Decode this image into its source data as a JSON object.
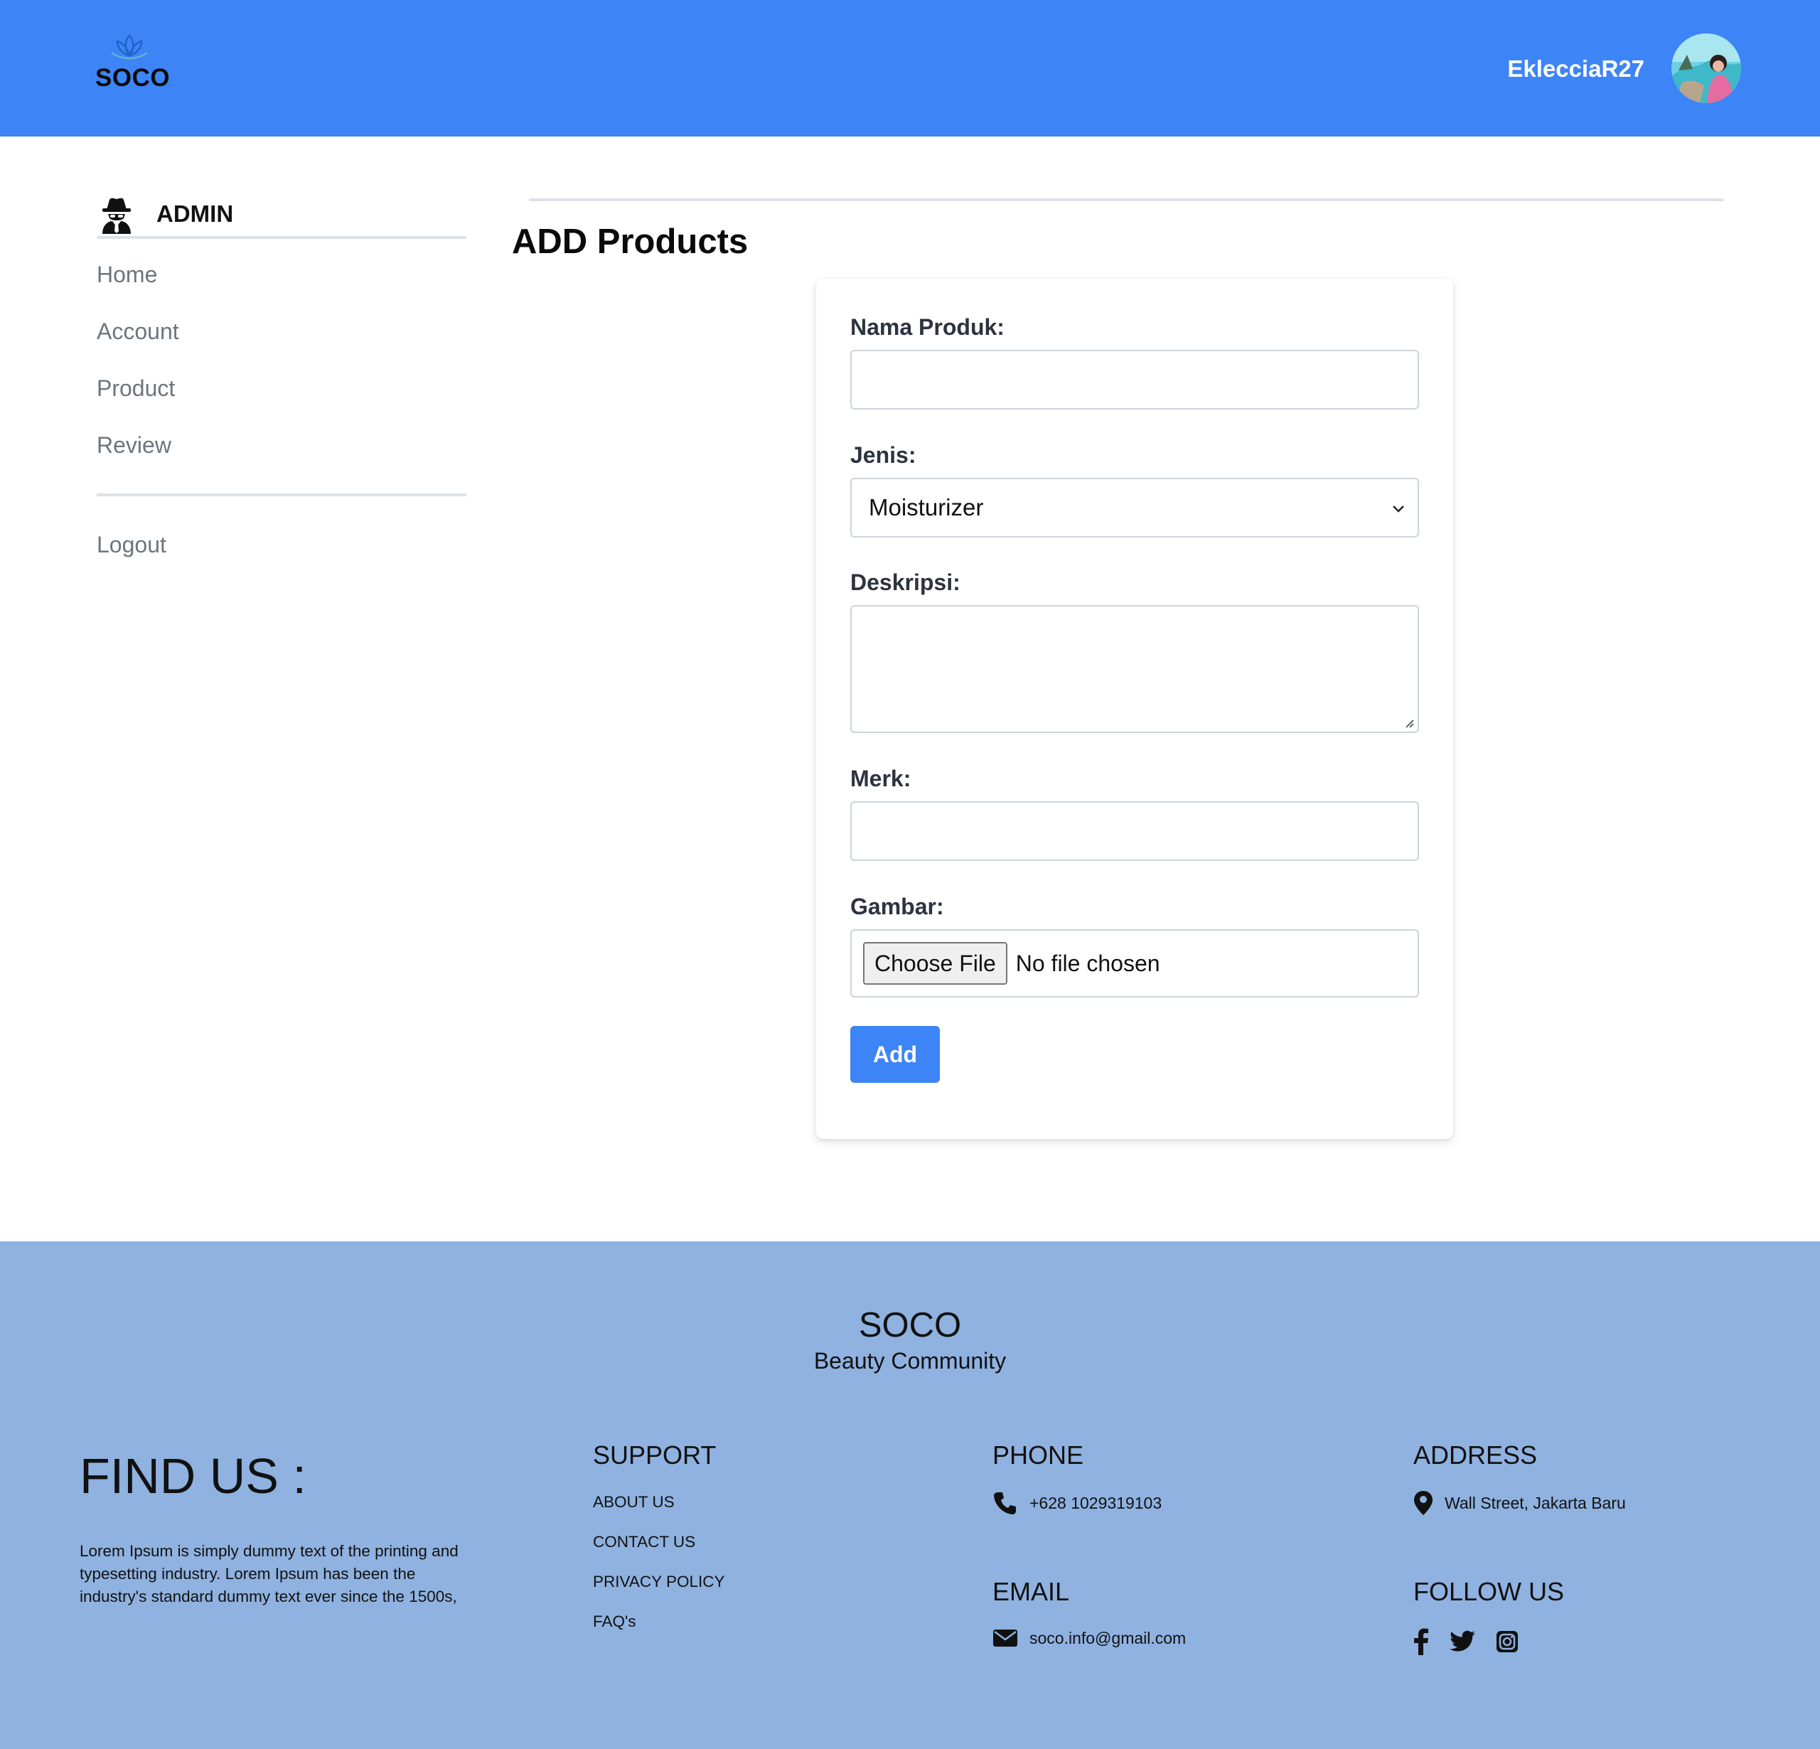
{
  "header": {
    "brand": "SOCO",
    "username": "EklecciaR27"
  },
  "sidebar": {
    "title": "ADMIN",
    "items": [
      {
        "label": "Home"
      },
      {
        "label": "Account"
      },
      {
        "label": "Product"
      },
      {
        "label": "Review"
      }
    ],
    "logout": "Logout"
  },
  "main": {
    "title": "ADD Products",
    "form": {
      "nama_label": "Nama Produk:",
      "nama_value": "",
      "jenis_label": "Jenis:",
      "jenis_value": "Moisturizer",
      "deskripsi_label": "Deskripsi:",
      "deskripsi_value": "",
      "merk_label": "Merk:",
      "merk_value": "",
      "gambar_label": "Gambar:",
      "choose_file": "Choose File",
      "no_file": "No file chosen",
      "submit": "Add"
    }
  },
  "footer": {
    "brand": "SOCO",
    "tagline": "Beauty Community",
    "find_us": "FIND US :",
    "about_text": "Lorem Ipsum is simply dummy text of the printing and typesetting industry. Lorem Ipsum has been the industry's standard dummy text ever since the 1500s,",
    "support": {
      "title": "SUPPORT",
      "links": [
        "ABOUT US",
        "CONTACT US",
        "PRIVACY POLICY",
        "FAQ's"
      ]
    },
    "phone": {
      "title": "PHONE",
      "value": "+628 1029319103"
    },
    "email": {
      "title": "EMAIL",
      "value": "soco.info@gmail.com"
    },
    "address": {
      "title": "ADDRESS",
      "value": "Wall Street, Jakarta Baru"
    },
    "follow": {
      "title": "FOLLOW US",
      "icons": [
        "facebook-icon",
        "twitter-icon",
        "instagram-icon"
      ]
    }
  },
  "colors": {
    "header_bg": "#3d84f6",
    "footer_bg": "#8fb2e0",
    "button_bg": "#3d84f6",
    "sidebar_link": "#6c757d"
  }
}
